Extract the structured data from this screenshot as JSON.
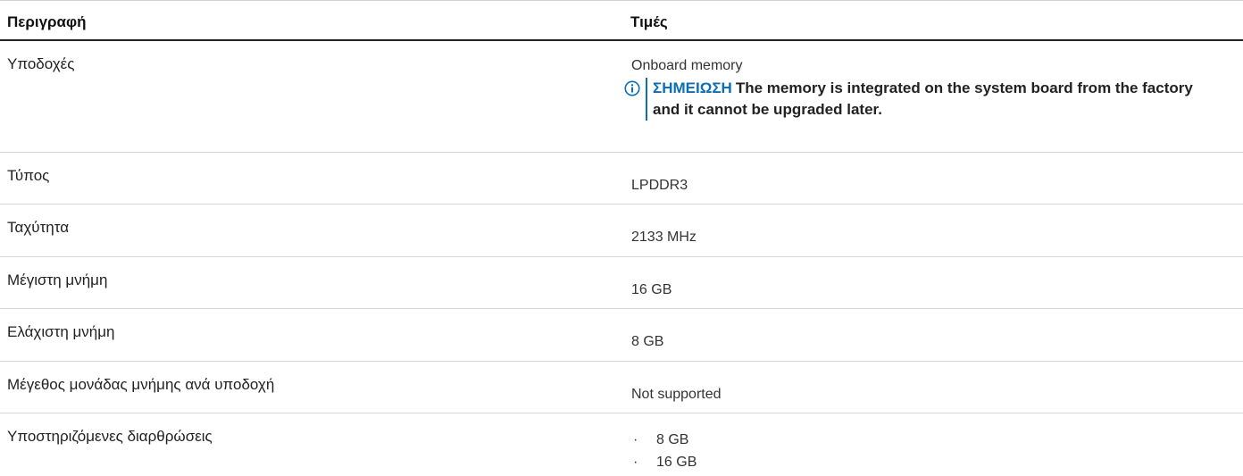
{
  "table": {
    "header": {
      "description": "Περιγραφή",
      "values": "Τιμές"
    },
    "rows": [
      {
        "label": "Υποδοχές",
        "value": "Onboard memory",
        "note": {
          "label": "ΣΗΜΕΙΩΣΗ",
          "text": "The memory is integrated on the system board from the factory and it cannot be upgraded later."
        }
      },
      {
        "label": "Τύπος",
        "value": "LPDDR3"
      },
      {
        "label": "Ταχύτητα",
        "value": "2133 MHz"
      },
      {
        "label": "Μέγιστη μνήμη",
        "value": "16 GB"
      },
      {
        "label": "Ελάχιστη μνήμη",
        "value": "8 GB"
      },
      {
        "label": "Μέγεθος μονάδας μνήμης ανά υποδοχή",
        "value": "Not supported"
      },
      {
        "label": "Υποστηριζόμενες διαρθρώσεις",
        "values": [
          "8 GB",
          "16 GB"
        ]
      }
    ]
  },
  "icons": {
    "note_icon": "info-circle-icon"
  },
  "colors": {
    "accent": "#0b6fb8",
    "text": "#222222",
    "rule": "#d8d8d8"
  }
}
